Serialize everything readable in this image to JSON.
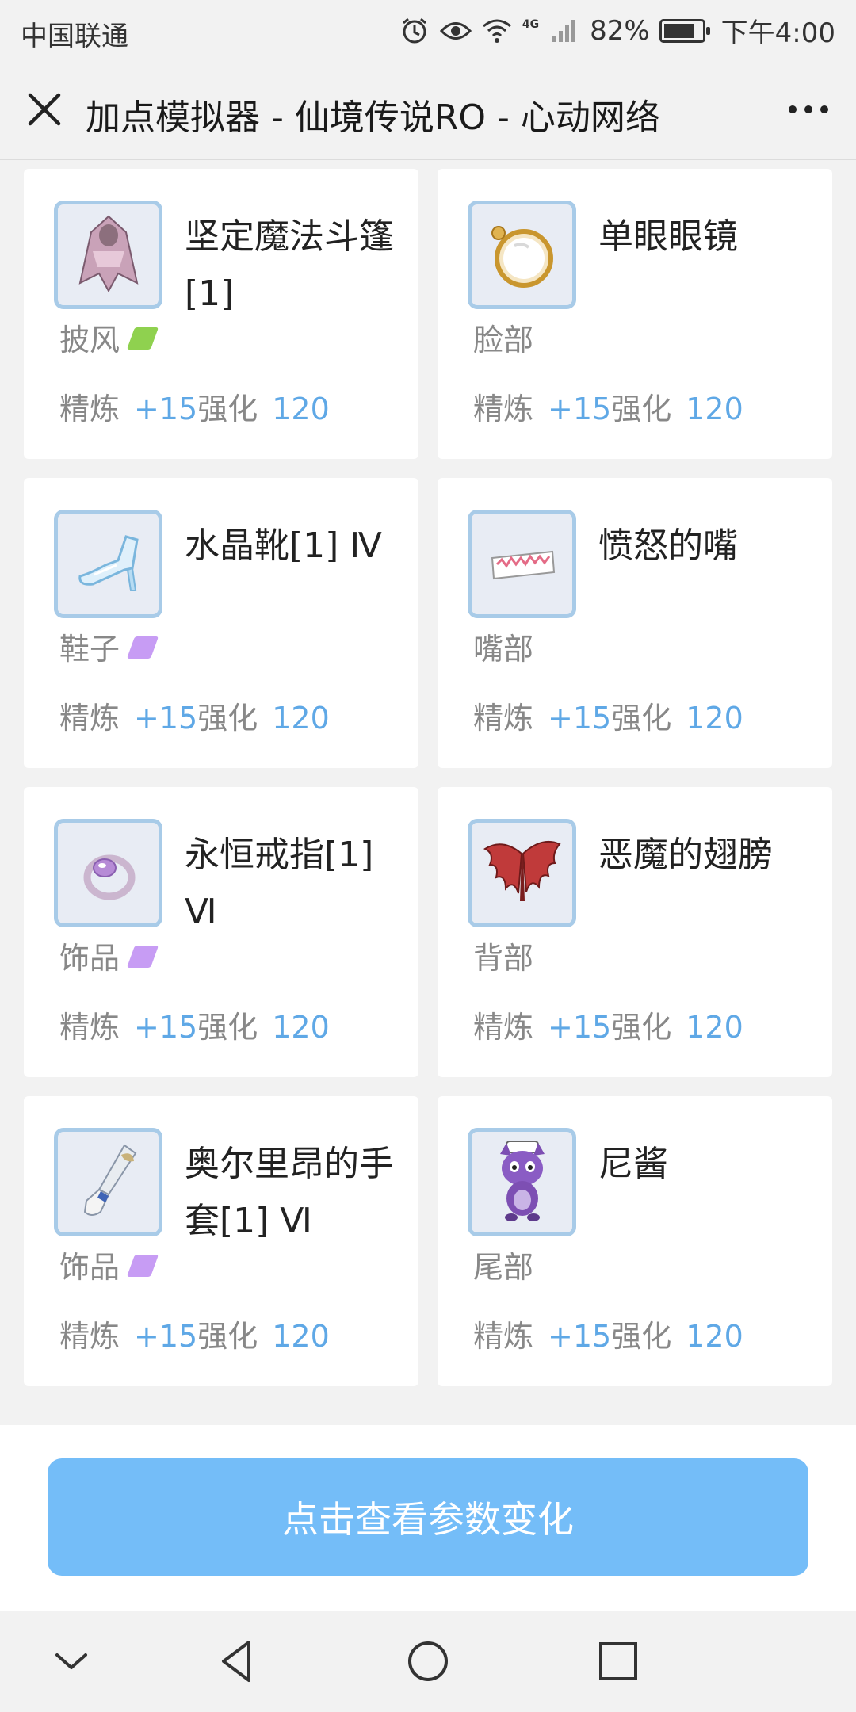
{
  "status_bar": {
    "carrier": "中国联通",
    "network_label": "4G",
    "battery_percent": "82%",
    "time": "下午4:00",
    "battery_level": 0.82,
    "icons": [
      "alarm-icon",
      "eye-icon",
      "wifi-icon",
      "signal-icon",
      "battery-icon"
    ]
  },
  "header": {
    "title": "加点模拟器 - 仙境传说RO - 心动网络",
    "close_icon": "close-icon",
    "more_icon": "more-icon"
  },
  "equipment": [
    {
      "name": "坚定魔法斗篷[1]",
      "slot": "披风",
      "tag_color": "#8fd14f",
      "icon": "cloak-icon",
      "refine_label": "精炼",
      "refine_value": "+15",
      "enhance_label": "强化",
      "enhance_value": "120"
    },
    {
      "name": "单眼眼镜",
      "slot": "脸部",
      "tag_color": "",
      "icon": "monocle-icon",
      "refine_label": "精炼",
      "refine_value": "+15",
      "enhance_label": "强化",
      "enhance_value": "120"
    },
    {
      "name": "水晶靴[1] Ⅳ",
      "slot": "鞋子",
      "tag_color": "#c79cf4",
      "icon": "crystal-shoe-icon",
      "refine_label": "精炼",
      "refine_value": "+15",
      "enhance_label": "强化",
      "enhance_value": "120"
    },
    {
      "name": "愤怒的嘴",
      "slot": "嘴部",
      "tag_color": "",
      "icon": "angry-mouth-icon",
      "refine_label": "精炼",
      "refine_value": "+15",
      "enhance_label": "强化",
      "enhance_value": "120"
    },
    {
      "name": "永恒戒指[1] Ⅵ",
      "slot": "饰品",
      "tag_color": "#c79cf4",
      "icon": "ring-icon",
      "refine_label": "精炼",
      "refine_value": "+15",
      "enhance_label": "强化",
      "enhance_value": "120"
    },
    {
      "name": "恶魔的翅膀",
      "slot": "背部",
      "tag_color": "",
      "icon": "demon-wings-icon",
      "refine_label": "精炼",
      "refine_value": "+15",
      "enhance_label": "强化",
      "enhance_value": "120"
    },
    {
      "name": "奥尔里昂的手套[1] Ⅵ",
      "slot": "饰品",
      "tag_color": "#c79cf4",
      "icon": "glove-icon",
      "refine_label": "精炼",
      "refine_value": "+15",
      "enhance_label": "强化",
      "enhance_value": "120"
    },
    {
      "name": "尼酱",
      "slot": "尾部",
      "tag_color": "",
      "icon": "purple-cat-icon",
      "refine_label": "精炼",
      "refine_value": "+15",
      "enhance_label": "强化",
      "enhance_value": "120"
    }
  ],
  "footer": {
    "button_label": "点击查看参数变化",
    "button_color": "#74bdf8"
  },
  "nav_bar": {
    "icons": [
      "chevron-down-icon",
      "back-icon",
      "home-icon",
      "recents-icon"
    ]
  }
}
